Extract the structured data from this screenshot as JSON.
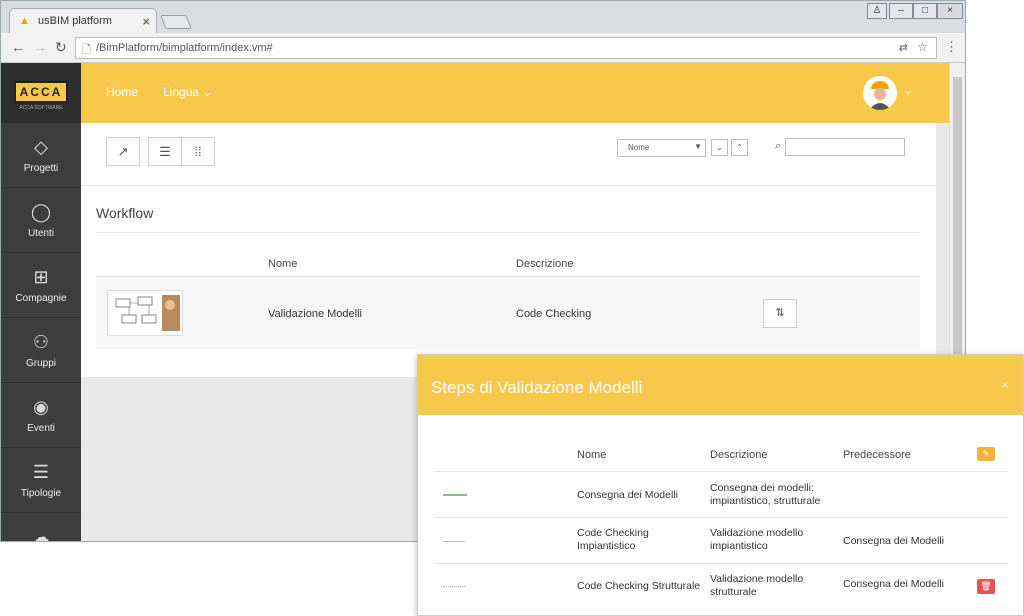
{
  "browser": {
    "tab_title": "usBIM platform",
    "url": "/BimPlatform/bimplatform/index.vm#"
  },
  "brand": {
    "logo": "ACCA",
    "logo_sub": "ACCA SOFTWARE"
  },
  "sidebar": {
    "items": [
      {
        "label": "Progetti",
        "icon": "diamond-icon"
      },
      {
        "label": "Utenti",
        "icon": "user-icon"
      },
      {
        "label": "Compagnie",
        "icon": "hierarchy-icon"
      },
      {
        "label": "Gruppi",
        "icon": "group-icon"
      },
      {
        "label": "Eventi",
        "icon": "eye-icon"
      },
      {
        "label": "Tipologie",
        "icon": "list-icon"
      }
    ]
  },
  "topbar": {
    "home": "Home",
    "lingua": "Lingua"
  },
  "toolbar": {
    "sort_value": "Nome",
    "search_placeholder": ""
  },
  "workflow": {
    "title": "Workflow",
    "col_nome": "Nome",
    "col_descrizione": "Descrizione",
    "rows": [
      {
        "nome": "Validazione Modelli",
        "descrizione": "Code Checking"
      }
    ]
  },
  "modal": {
    "title": "Steps di Validazione Modelli",
    "col_nome": "Nome",
    "col_descrizione": "Descrizione",
    "col_predecessore": "Predecessore",
    "rows": [
      {
        "nome": "Consegna dei Modelli",
        "descrizione": "Consegna dei modelli: impiantistico, strutturale",
        "predecessore": ""
      },
      {
        "nome": "Code Checking Impiantistico",
        "descrizione": "Validazione modello impiantistico",
        "predecessore": "Consegna dei Modelli"
      },
      {
        "nome": "Code Checking Strutturale",
        "descrizione": "Validazione modello strutturale",
        "predecessore": "Consegna dei Modelli"
      }
    ]
  },
  "colors": {
    "accent": "#f7c84a",
    "sidebar": "#3d3d3d",
    "danger": "#e05552"
  }
}
